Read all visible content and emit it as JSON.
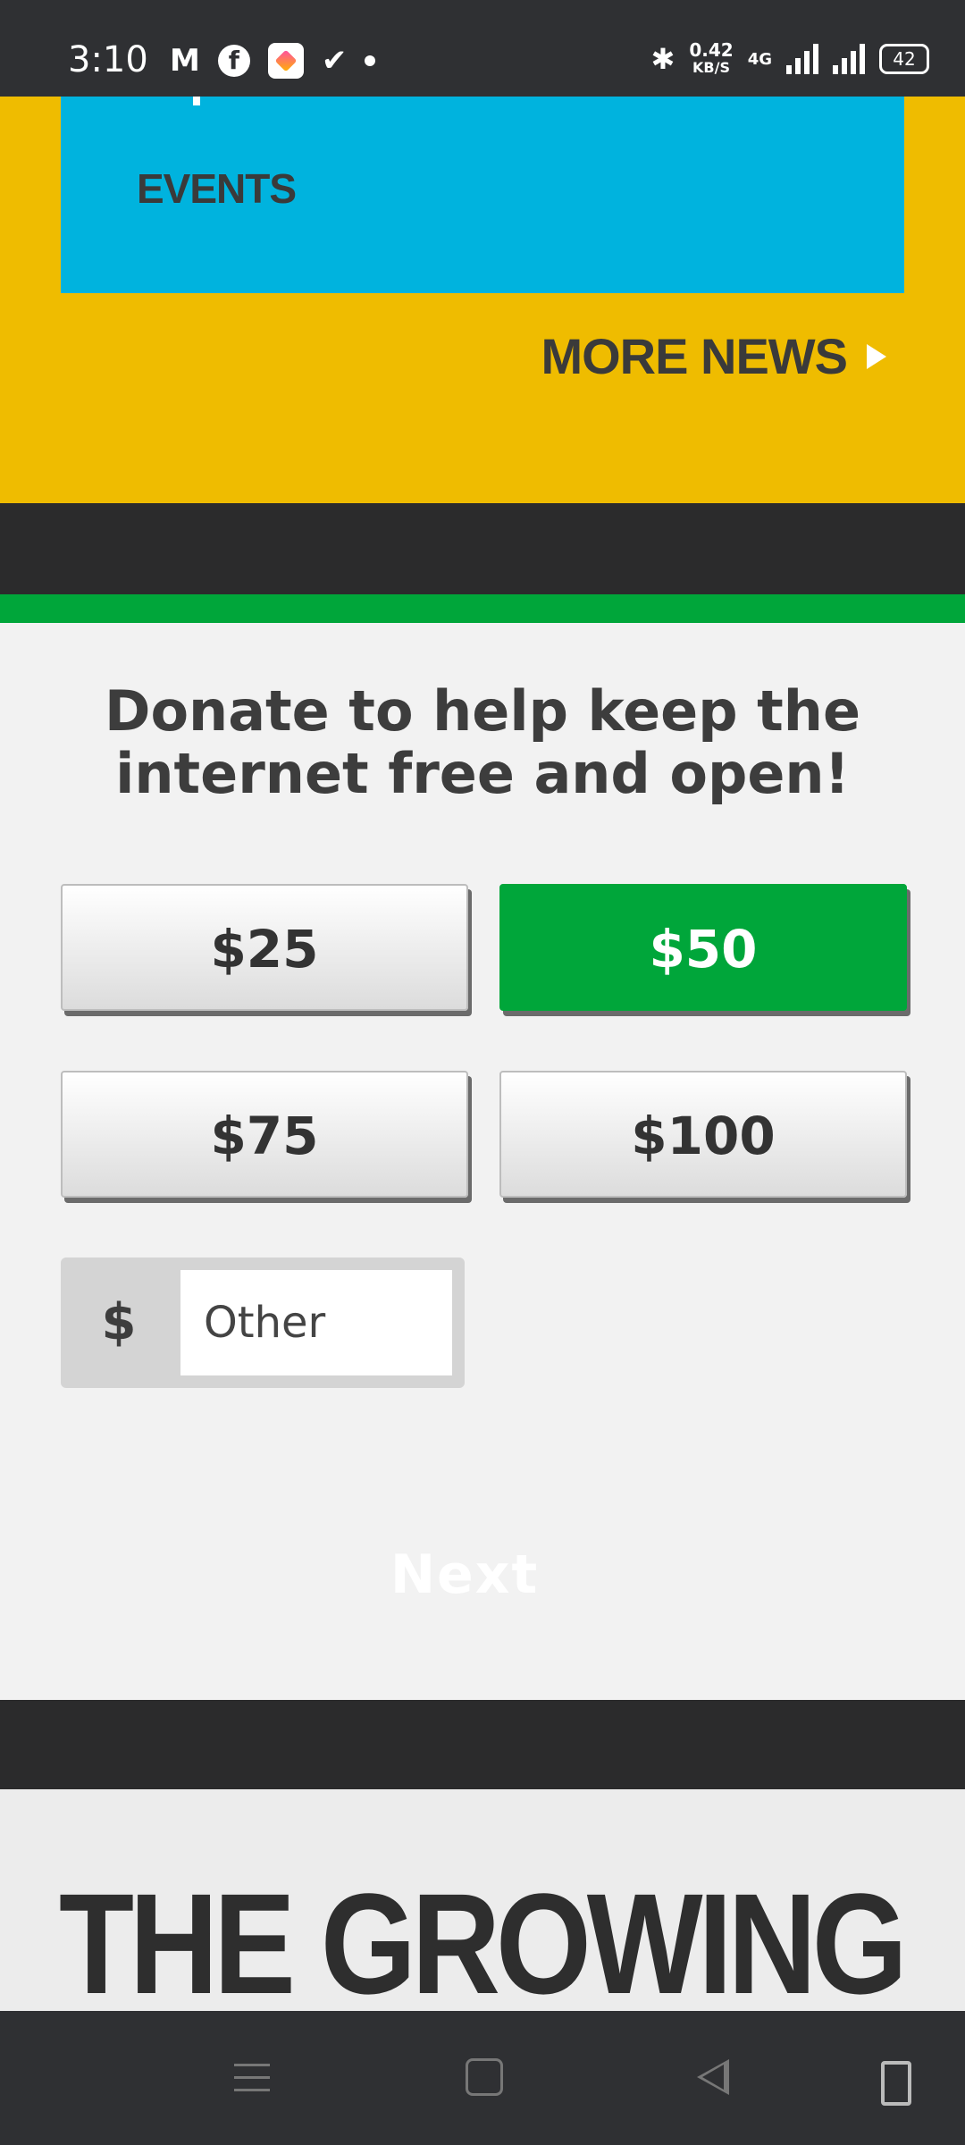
{
  "status_bar": {
    "time": "3:10",
    "net_speed_value": "0.42",
    "net_speed_unit": "KB/S",
    "network_type": "4G",
    "battery": "42"
  },
  "news": {
    "events_label": "EVENTS",
    "more_news_label": "MORE NEWS"
  },
  "donate": {
    "title": "Donate to help keep the internet free and open!",
    "amounts": [
      "$25",
      "$50",
      "$75",
      "$100"
    ],
    "selected_amount": "$50",
    "other_currency": "$",
    "other_placeholder": "Other",
    "next_label": "Next"
  },
  "feature": {
    "title": "THE GROWING"
  },
  "colors": {
    "yellow": "#efbc00",
    "cyan": "#00b3de",
    "green": "#00a63a",
    "dark": "#2b2b2c"
  },
  "icons": [
    "gmail-icon",
    "facebook-icon",
    "app-icon",
    "check-icon",
    "bluetooth-icon",
    "signal-icon",
    "battery-icon",
    "menu-icon",
    "home-icon",
    "back-icon",
    "rotate-icon"
  ]
}
